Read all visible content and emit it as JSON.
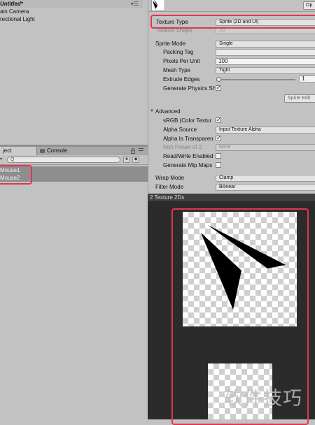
{
  "hierarchy": {
    "scene_title": "Untitled*",
    "items": [
      "ain Camera",
      "rectional Light"
    ]
  },
  "project_panel": {
    "tabs": [
      "ject",
      "Console"
    ],
    "search_glyph": "Q",
    "assets": [
      "Mouse1",
      "Mouse2"
    ]
  },
  "inspector": {
    "open_button": "Op",
    "texture_type_label": "Texture Type",
    "texture_type_value": "Sprite (2D and UI)",
    "texture_shape_label": "Texture Shape",
    "texture_shape_value": "2D",
    "sprite_mode_label": "Sprite Mode",
    "sprite_mode_value": "Single",
    "packing_tag_label": "Packing Tag",
    "packing_tag_value": "",
    "pixels_per_unit_label": "Pixels Per Unit",
    "pixels_per_unit_value": "100",
    "mesh_type_label": "Mesh Type",
    "mesh_type_value": "Tight",
    "extrude_edges_label": "Extrude Edges",
    "extrude_edges_value": "1",
    "generate_physics_label": "Generate Physics Sh",
    "generate_physics_checked": true,
    "sprite_editor_button": "Sprite Edit",
    "advanced_label": "Advanced",
    "srgb_label": "sRGB (Color Textur",
    "srgb_checked": true,
    "alpha_source_label": "Alpha Source",
    "alpha_source_value": "Input Texture Alpha",
    "alpha_transparency_label": "Alpha Is Transparen",
    "alpha_transparency_checked": true,
    "non_power_label": "Non Power of 2",
    "non_power_value": "None",
    "read_write_label": "Read/Write Enabled",
    "read_write_checked": false,
    "mip_maps_label": "Generate Mip Maps",
    "mip_maps_checked": false,
    "wrap_mode_label": "Wrap Mode",
    "wrap_mode_value": "Clamp",
    "filter_mode_label": "Filter Mode",
    "filter_mode_value": "Bilinear",
    "check_glyph": "✓"
  },
  "preview": {
    "header": "2 Texture 2Ds"
  },
  "watermark": "软件技巧",
  "colors": {
    "highlight_red": "#e3364e",
    "selected_row": "#8e8e8e",
    "preview_bg": "#2b2b2b"
  }
}
